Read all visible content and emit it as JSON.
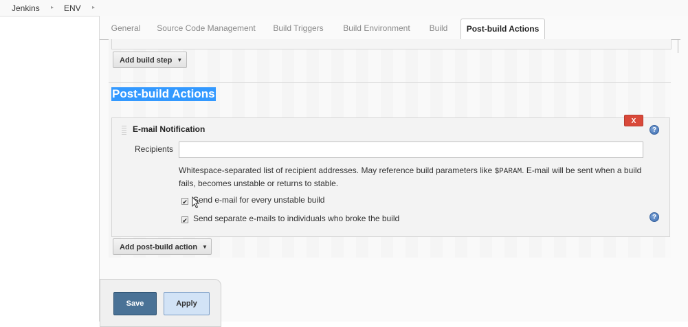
{
  "breadcrumb": {
    "items": [
      "Jenkins",
      "ENV"
    ],
    "separator": "▸"
  },
  "tabs": [
    {
      "label": "General",
      "active": false
    },
    {
      "label": "Source Code Management",
      "active": false
    },
    {
      "label": "Build Triggers",
      "active": false
    },
    {
      "label": "Build Environment",
      "active": false
    },
    {
      "label": "Build",
      "active": false
    },
    {
      "label": "Post-build Actions",
      "active": true
    }
  ],
  "build": {
    "add_step_label": "Add build step"
  },
  "post_build": {
    "section_title": "Post-build Actions",
    "email": {
      "title": "E-mail Notification",
      "delete_label": "X",
      "recipients_label": "Recipients",
      "recipients_value": "",
      "help_text_pre": "Whitespace-separated list of recipient addresses. May reference build parameters like ",
      "help_text_code": "$PARAM",
      "help_text_post": ". E-mail will be sent when a build fails, becomes unstable or returns to stable.",
      "options": [
        {
          "label": "Send e-mail for every unstable build",
          "checked": true
        },
        {
          "label": "Send separate e-mails to individuals who broke the build",
          "checked": true
        }
      ]
    },
    "add_action_label": "Add post-build action"
  },
  "footer": {
    "save_label": "Save",
    "apply_label": "Apply"
  },
  "icons": {
    "help": "help-icon",
    "dropdown": "caret-down-icon",
    "drag": "drag-handle-icon",
    "checkbox_mark": "✔"
  },
  "colors": {
    "delete_button": "#d9493a",
    "save_button": "#4a7296",
    "apply_button": "#d2e3f6",
    "selection_highlight": "#3399ff"
  }
}
